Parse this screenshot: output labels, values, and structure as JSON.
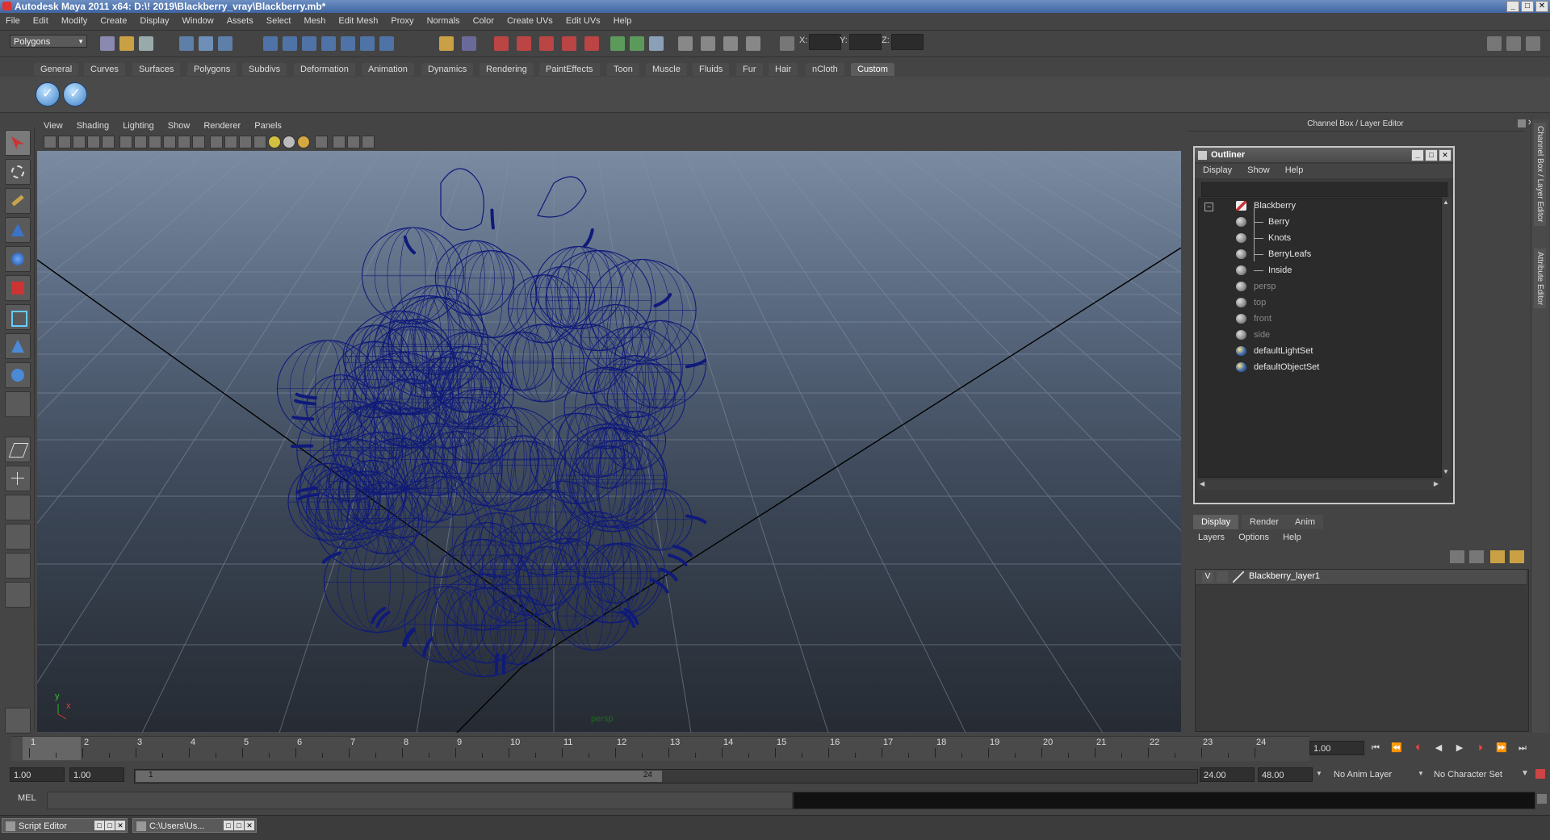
{
  "window": {
    "title": "Autodesk Maya 2011 x64: D:\\! 2019\\Blackberry_vray\\Blackberry.mb*",
    "buttons": [
      "minimize",
      "maximize",
      "close"
    ]
  },
  "menubar": [
    "File",
    "Edit",
    "Modify",
    "Create",
    "Display",
    "Window",
    "Assets",
    "Select",
    "Mesh",
    "Edit Mesh",
    "Proxy",
    "Normals",
    "Color",
    "Create UVs",
    "Edit UVs",
    "Help"
  ],
  "statusline": {
    "mode": "Polygons",
    "x_label": "X:",
    "y_label": "Y:",
    "z_label": "Z:"
  },
  "shelf": {
    "tabs": [
      "General",
      "Curves",
      "Surfaces",
      "Polygons",
      "Subdivs",
      "Deformation",
      "Animation",
      "Dynamics",
      "Rendering",
      "PaintEffects",
      "Toon",
      "Muscle",
      "Fluids",
      "Fur",
      "Hair",
      "nCloth",
      "Custom"
    ],
    "active_tab": "Custom",
    "button_icons": [
      "check-icon",
      "check-icon"
    ]
  },
  "viewport": {
    "menu": [
      "View",
      "Shading",
      "Lighting",
      "Show",
      "Renderer",
      "Panels"
    ],
    "camera_label": "persp",
    "axis_x": "x",
    "axis_y": "y",
    "wire_color": "#0f1a7a"
  },
  "channelbox": {
    "title": "Channel Box / Layer Editor",
    "side_tabs": [
      "Channel Box / Layer Editor",
      "Attribute Editor"
    ]
  },
  "outliner": {
    "title": "Outliner",
    "menu": [
      "Display",
      "Show",
      "Help"
    ],
    "items": [
      {
        "label": "Blackberry",
        "icon": "group-icon",
        "dim": false,
        "level": 0
      },
      {
        "label": "Berry",
        "icon": "mesh-icon",
        "dim": false,
        "level": 1
      },
      {
        "label": "Knots",
        "icon": "mesh-icon",
        "dim": false,
        "level": 1
      },
      {
        "label": "BerryLeafs",
        "icon": "mesh-icon",
        "dim": false,
        "level": 1
      },
      {
        "label": "Inside",
        "icon": "mesh-icon",
        "dim": false,
        "level": 1
      },
      {
        "label": "persp",
        "icon": "camera-icon",
        "dim": true,
        "level": 0
      },
      {
        "label": "top",
        "icon": "camera-icon",
        "dim": true,
        "level": 0
      },
      {
        "label": "front",
        "icon": "camera-icon",
        "dim": true,
        "level": 0
      },
      {
        "label": "side",
        "icon": "camera-icon",
        "dim": true,
        "level": 0
      },
      {
        "label": "defaultLightSet",
        "icon": "set-icon",
        "dim": false,
        "level": 0
      },
      {
        "label": "defaultObjectSet",
        "icon": "set-icon",
        "dim": false,
        "level": 0
      }
    ]
  },
  "layer_editor": {
    "tabs": [
      "Display",
      "Render",
      "Anim"
    ],
    "active_tab": "Display",
    "menu": [
      "Layers",
      "Options",
      "Help"
    ],
    "layers": [
      {
        "visible": "V",
        "name": "Blackberry_layer1"
      }
    ]
  },
  "timeslider": {
    "frames": [
      "1",
      "2",
      "3",
      "4",
      "5",
      "6",
      "7",
      "8",
      "9",
      "10",
      "11",
      "12",
      "13",
      "14",
      "15",
      "16",
      "17",
      "18",
      "19",
      "20",
      "21",
      "22",
      "23",
      "24"
    ],
    "current_frame": "1.00"
  },
  "rangeslider": {
    "start": "1.00",
    "start_inner": "1.00",
    "range_start_label": "1",
    "range_end_label": "24",
    "end_inner": "24.00",
    "end": "48.00",
    "anim_layer": "No Anim Layer",
    "character_set": "No Character Set"
  },
  "commandline": {
    "label": "MEL"
  },
  "taskbar": [
    {
      "label": "Script Editor"
    },
    {
      "label": "C:\\Users\\Us..."
    }
  ]
}
